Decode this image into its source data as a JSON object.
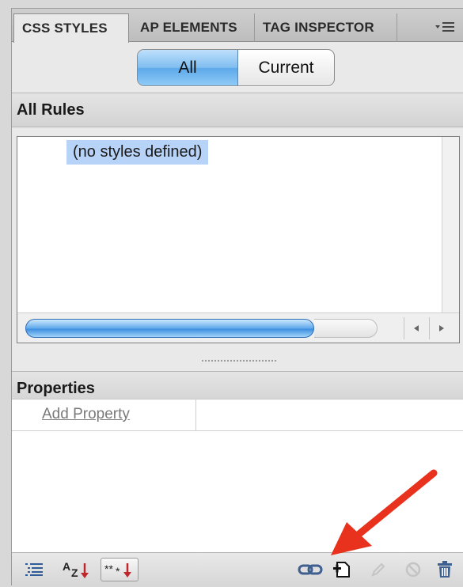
{
  "tabs": [
    {
      "label": "CSS STYLES",
      "active": true
    },
    {
      "label": "AP ELEMENTS",
      "active": false
    },
    {
      "label": "TAG INSPECTOR",
      "active": false
    }
  ],
  "panel_menu_icon": "panel-menu-icon",
  "mode_toggle": {
    "options": [
      "All",
      "Current"
    ],
    "selected": "All"
  },
  "all_rules": {
    "header": "All Rules",
    "items": [
      "(no styles defined)"
    ]
  },
  "properties": {
    "header": "Properties",
    "add_property_label": "Add Property"
  },
  "toolbar": {
    "icons": [
      "show-category-view-icon",
      "show-alphabetical-view-icon",
      "show-set-properties-only-icon",
      "attach-style-sheet-icon",
      "new-css-rule-icon",
      "edit-style-icon",
      "disable-css-property-icon",
      "delete-css-rule-icon"
    ]
  },
  "colors": {
    "selection_highlight": "#b7d3f7",
    "accent_blue": "#5da9ea",
    "annotation_arrow": "#e8321e"
  }
}
